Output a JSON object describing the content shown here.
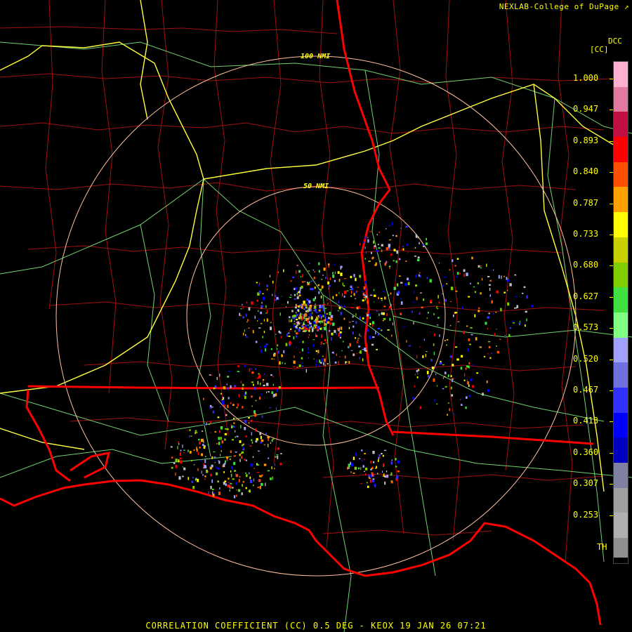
{
  "credit": "NEXLAB-College of DuPage",
  "credit_icon": "external-link-icon",
  "legend": {
    "product": "DCC",
    "unit": "[CC]",
    "ticks": [
      "1.000",
      "0.947",
      "0.893",
      "0.840",
      "0.787",
      "0.733",
      "0.680",
      "0.627",
      "0.573",
      "0.520",
      "0.467",
      "0.413",
      "0.360",
      "0.307",
      "0.253"
    ],
    "threshold_label": "TH",
    "colors": [
      "#ffb0d0",
      "#e07aa0",
      "#c01040",
      "#ff0000",
      "#ff5000",
      "#ffa000",
      "#ffff00",
      "#c8d000",
      "#80d000",
      "#40e040",
      "#80ff80",
      "#a0a0ff",
      "#7070e0",
      "#3030ff",
      "#0000ff",
      "#0000c0",
      "#8080a0",
      "#a0a0a0",
      "#b0b0b0",
      "#909090"
    ]
  },
  "range_rings": [
    "100 NMI",
    "50 NMI"
  ],
  "caption": "CORRELATION COEFFICIENT (CC) 0.5 DEG - KEOX 19 JAN 26 07:21",
  "colors": {
    "borders": "#ff0000",
    "counties": "#b01010",
    "highways": "#ffff40",
    "roads": "#70d070",
    "rings": "#ffc0a0"
  }
}
